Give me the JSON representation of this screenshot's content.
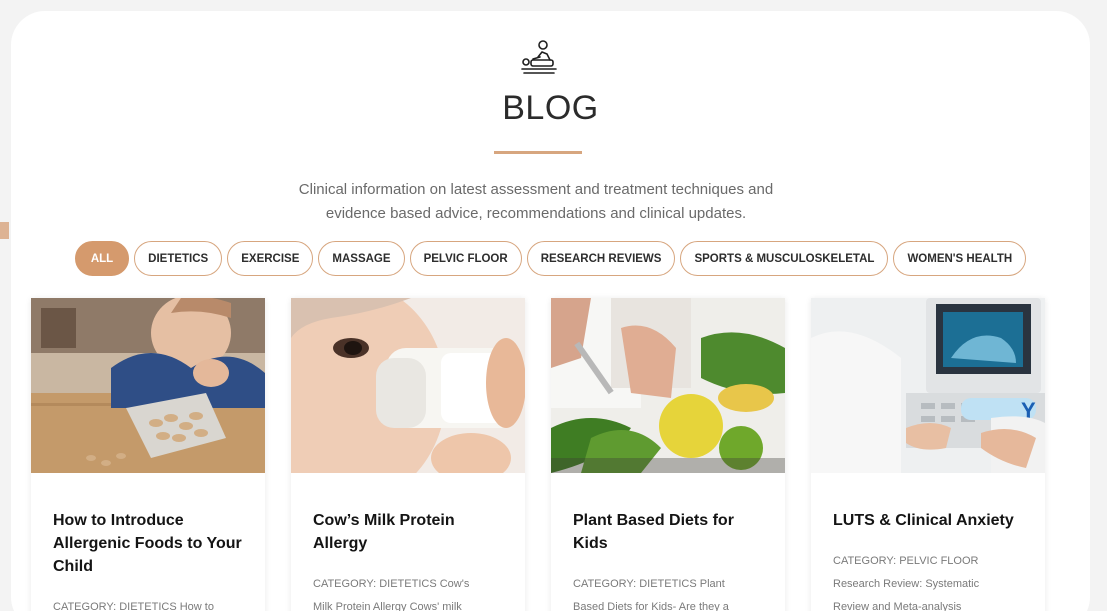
{
  "header": {
    "title": "BLOG",
    "intro_line1": "Clinical information on latest assessment and treatment techniques and",
    "intro_line2": "evidence based advice, recommendations and clinical updates."
  },
  "icons": {
    "logo": "massage-therapy-icon"
  },
  "colors": {
    "accent": "#d59a6d",
    "chip_border": "#d7a67f"
  },
  "filters": [
    {
      "label": "ALL",
      "active": true
    },
    {
      "label": "DIETETICS",
      "active": false
    },
    {
      "label": "EXERCISE",
      "active": false
    },
    {
      "label": "MASSAGE",
      "active": false
    },
    {
      "label": "PELVIC FLOOR",
      "active": false
    },
    {
      "label": "RESEARCH REVIEWS",
      "active": false
    },
    {
      "label": "SPORTS & MUSCULOSKELETAL",
      "active": false
    },
    {
      "label": "WOMEN'S HEALTH",
      "active": false
    }
  ],
  "posts": [
    {
      "title": "How to Introduce Allergenic Foods to Your Child",
      "excerpt": [
        "CATEGORY: DIETETICS How to"
      ]
    },
    {
      "title": "Cow’s Milk Protein Allergy",
      "excerpt": [
        "CATEGORY: DIETETICS Cow's",
        "Milk Protein Allergy Cows' milk"
      ]
    },
    {
      "title": "Plant Based Diets for Kids",
      "excerpt": [
        "CATEGORY: DIETETICS Plant",
        "Based Diets for Kids- Are they a"
      ]
    },
    {
      "title": "LUTS & Clinical Anxiety",
      "excerpt": [
        "CATEGORY: PELVIC FLOOR",
        "Research Review: Systematic",
        "Review and Meta-analysis"
      ]
    }
  ]
}
